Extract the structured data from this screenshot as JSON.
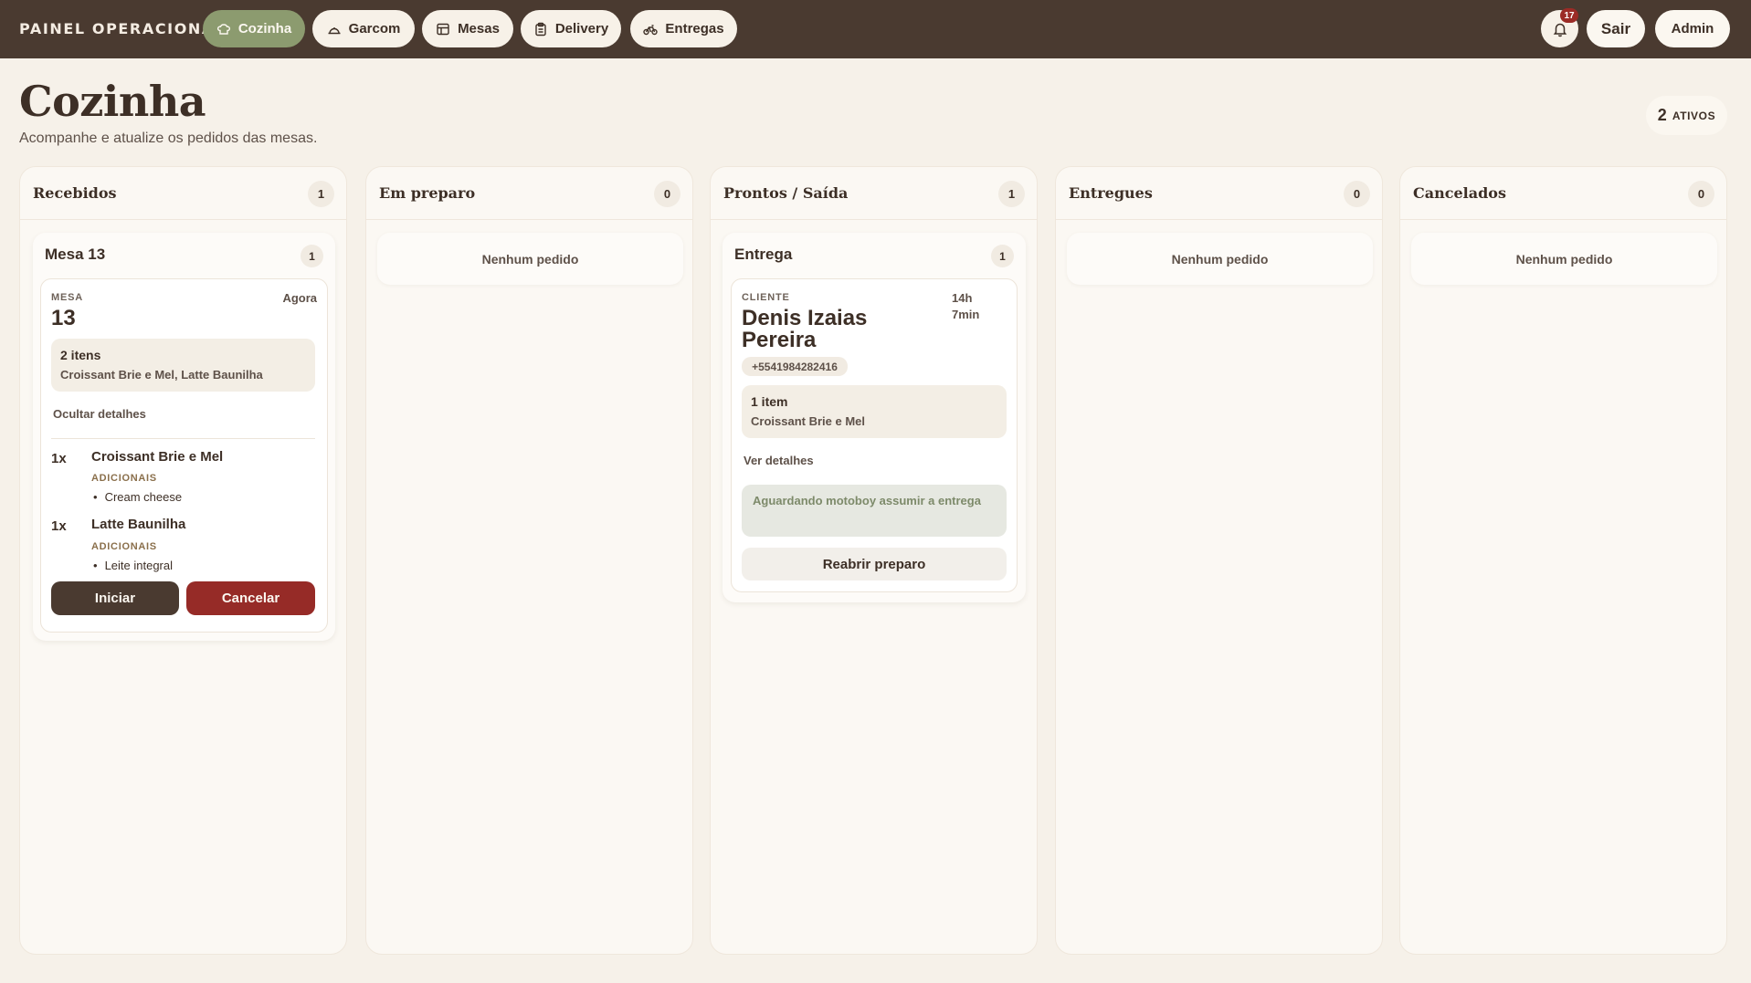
{
  "brand": "PAINEL OPERACIONAL",
  "nav": [
    {
      "label": "Cozinha",
      "icon": "chef-hat-icon",
      "active": true
    },
    {
      "label": "Garcom",
      "icon": "cloche-icon",
      "active": false
    },
    {
      "label": "Mesas",
      "icon": "table-icon",
      "active": false
    },
    {
      "label": "Delivery",
      "icon": "clipboard-icon",
      "active": false
    },
    {
      "label": "Entregas",
      "icon": "bike-icon",
      "active": false
    }
  ],
  "notifications": {
    "count": "17",
    "icon": "bell-icon"
  },
  "actions": {
    "logout": "Sair",
    "admin": "Admin"
  },
  "page": {
    "title": "Cozinha",
    "subtitle": "Acompanhe e atualize os pedidos das mesas.",
    "active_count": "2",
    "active_label": "ATIVOS"
  },
  "columns": [
    {
      "title": "Recebidos",
      "count": "1"
    },
    {
      "title": "Em preparo",
      "count": "0",
      "empty": "Nenhum pedido"
    },
    {
      "title": "Prontos / Saída",
      "count": "1"
    },
    {
      "title": "Entregues",
      "count": "0",
      "empty": "Nenhum pedido"
    },
    {
      "title": "Cancelados",
      "count": "0",
      "empty": "Nenhum pedido"
    }
  ],
  "received_group": {
    "title": "Mesa 13",
    "count": "1",
    "order": {
      "label": "MESA",
      "number": "13",
      "time": "Agora",
      "summary_count": "2 itens",
      "summary_names": "Croissant Brie e Mel, Latte Baunilha",
      "toggle": "Ocultar detalhes",
      "items": [
        {
          "qty": "1x",
          "name": "Croissant Brie e Mel",
          "addons_label": "ADICIONAIS",
          "addons": [
            "Cream cheese"
          ]
        },
        {
          "qty": "1x",
          "name": "Latte Baunilha",
          "addons_label": "ADICIONAIS",
          "addons": [
            "Leite integral"
          ]
        }
      ],
      "start": "Iniciar",
      "cancel": "Cancelar"
    }
  },
  "ready_group": {
    "title": "Entrega",
    "count": "1",
    "order": {
      "label": "CLIENTE",
      "client_line1": "Denis Izaias",
      "client_line2": "Pereira",
      "time_line1": "14h",
      "time_line2": "7min",
      "phone": "+5541984282416",
      "summary_count": "1 item",
      "summary_names": "Croissant Brie e Mel",
      "toggle": "Ver detalhes",
      "waiting": "Aguardando motoboy assumir a entrega",
      "reopen": "Reabrir preparo"
    }
  }
}
